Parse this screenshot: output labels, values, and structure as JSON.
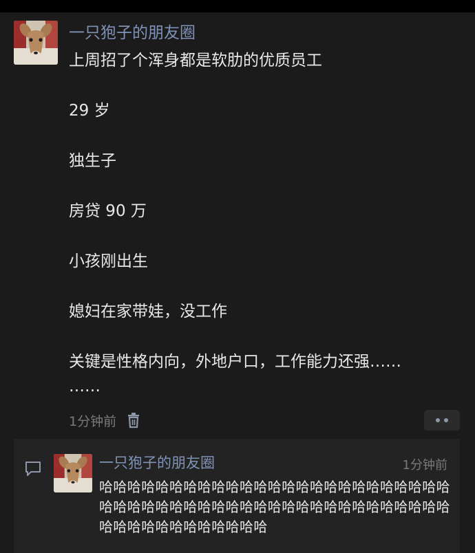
{
  "post": {
    "nickname": "一只狍子的朋友圈",
    "lines": [
      "上周招了个浑身都是软肋的优质员工",
      "29 岁",
      "独生子",
      "房贷 90 万",
      "小孩刚出生",
      "媳妇在家带娃，没工作",
      "关键是性格内向，外地户口，工作能力还强……",
      "……"
    ],
    "time": "1分钟前",
    "avatar_icon": "deer-avatar",
    "delete_icon": "trash-icon",
    "more_icon": "more-dots-icon"
  },
  "comment": {
    "icon": "comment-icon",
    "nickname": "一只狍子的朋友圈",
    "time": "1分钟前",
    "text": "哈哈哈哈哈哈哈哈哈哈哈哈哈哈哈哈哈哈哈哈哈哈哈哈哈哈哈哈哈哈哈哈哈哈哈哈哈哈哈哈哈哈哈哈哈哈哈哈哈哈哈哈哈哈哈哈哈哈哈哈哈哈"
  },
  "colors": {
    "background": "#1b1b1b",
    "nickname": "#7f93b7",
    "text": "#e8e8e8",
    "meta": "#7a7a7a",
    "comment_panel": "#232323"
  }
}
